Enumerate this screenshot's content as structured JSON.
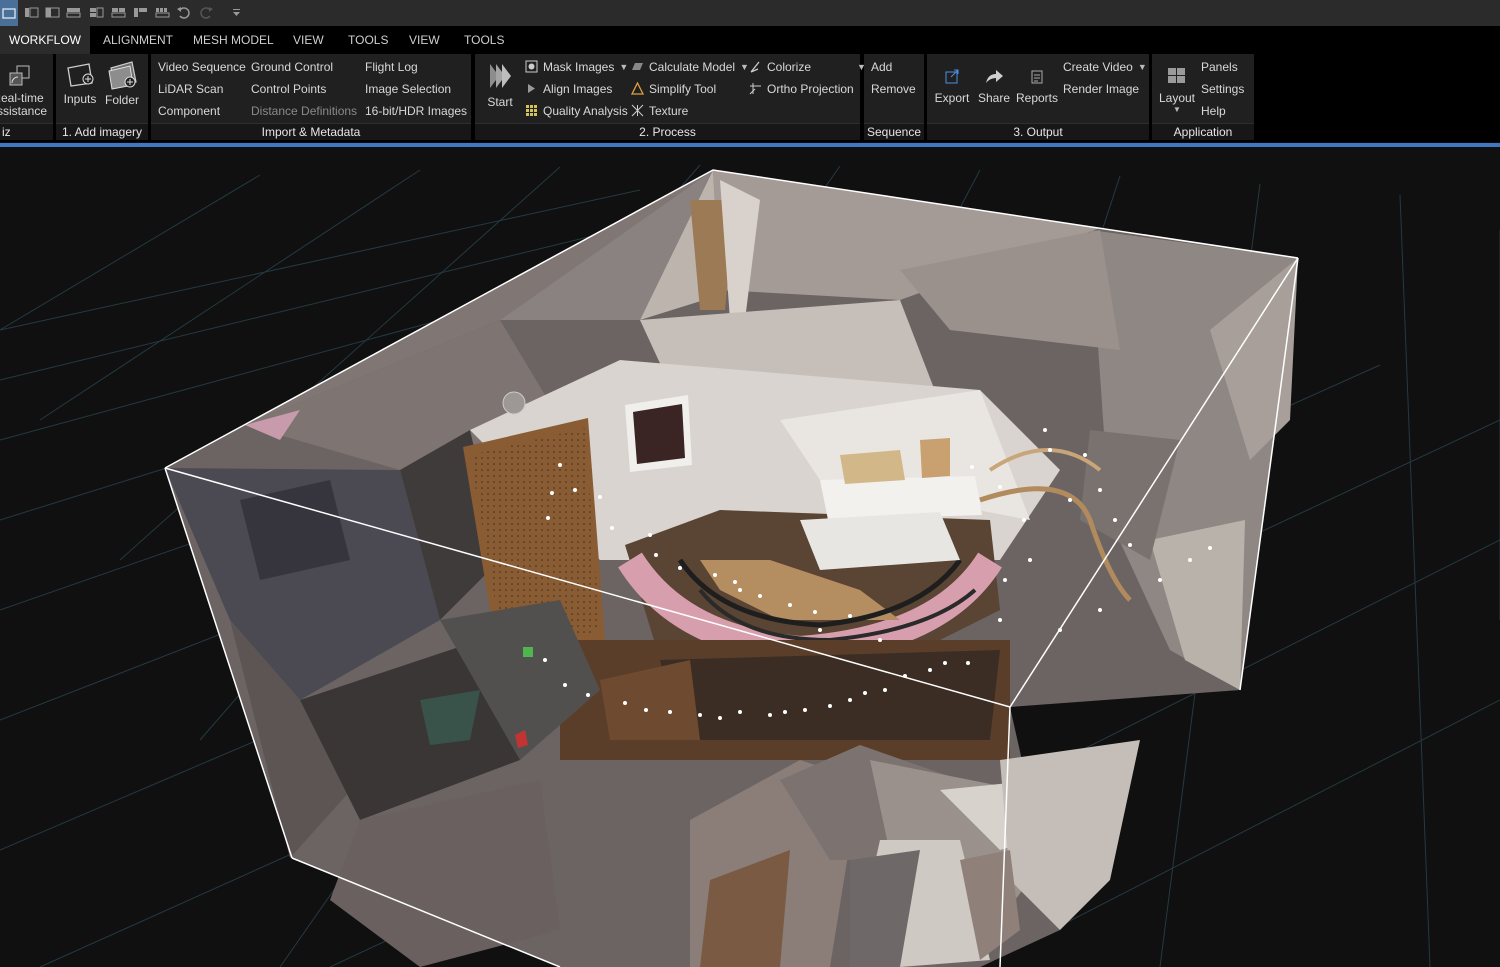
{
  "quick_access": {
    "icons": [
      "layout-1-icon",
      "layout-2-icon",
      "layout-3-icon",
      "layout-4-icon",
      "layout-5-icon",
      "layout-6-icon",
      "layout-7-icon",
      "layout-8-icon",
      "undo-icon",
      "redo-icon",
      "customize-dropdown-icon"
    ]
  },
  "tabs": [
    {
      "label": "WORKFLOW",
      "active": true
    },
    {
      "label": "ALIGNMENT"
    },
    {
      "label": "MESH MODEL"
    },
    {
      "label": "VIEW"
    },
    {
      "label": "TOOLS"
    },
    {
      "label": "VIEW"
    },
    {
      "label": "TOOLS"
    }
  ],
  "ribbon": {
    "viz": {
      "button": "Real-time\nAssistance",
      "label": "iz"
    },
    "add_imagery": {
      "inputs": "Inputs",
      "folder": "Folder",
      "label": "1. Add imagery"
    },
    "import": {
      "col1": [
        "Video Sequence",
        "LiDAR Scan",
        "Component"
      ],
      "col2": [
        "Ground Control",
        "Control Points",
        "Distance Definitions"
      ],
      "col3": [
        "Flight Log",
        "Image Selection",
        "16-bit/HDR Images"
      ],
      "label": "Import & Metadata"
    },
    "process": {
      "start": "Start",
      "col1": [
        "Mask Images",
        "Align Images",
        "Quality Analysis"
      ],
      "col2": [
        "Calculate Model",
        "Simplify Tool",
        "Texture"
      ],
      "col3": [
        "Colorize",
        "Ortho Projection"
      ],
      "label": "2. Process"
    },
    "sequence": {
      "items": [
        "Add",
        "Remove"
      ],
      "label": "Sequence"
    },
    "output": {
      "export": "Export",
      "share": "Share",
      "reports": "Reports",
      "create_video": "Create Video",
      "render_image": "Render Image",
      "label": "3. Output"
    },
    "application": {
      "layout": "Layout",
      "items": [
        "Panels",
        "Settings",
        "Help"
      ],
      "label": "Application"
    }
  },
  "colors": {
    "accent": "#3f78bf",
    "ribbon_bg": "#202020",
    "tab_active": "#2b2b2b",
    "grid": "#2a4550"
  }
}
